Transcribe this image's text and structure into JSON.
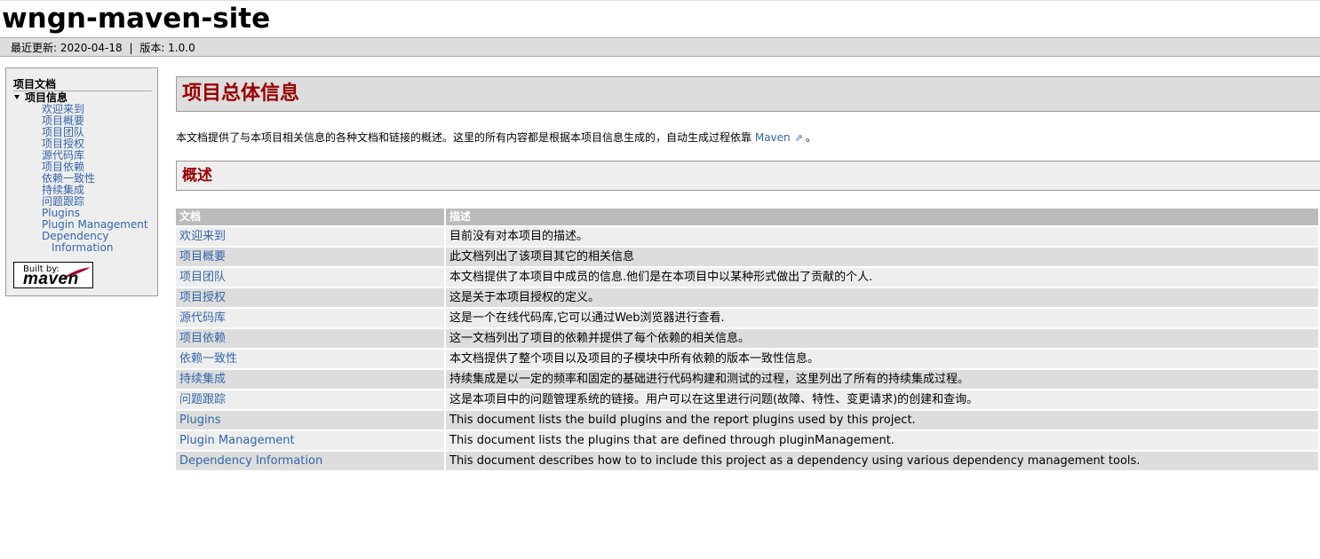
{
  "site": {
    "title": "wngn-maven-site"
  },
  "breadcrumbs": {
    "last_published": "最近更新: 2020-04-18",
    "separator": "|",
    "version": "版本: 1.0.0"
  },
  "nav": {
    "heading": "项目文档",
    "section": "项目信息",
    "items": [
      "欢迎来到",
      "项目概要",
      "项目团队",
      "项目授权",
      "源代码库",
      "项目依赖",
      "依赖一致性",
      "持续集成",
      "问题跟踪",
      "Plugins",
      "Plugin Management",
      "Dependency",
      "Information"
    ],
    "powered_by": {
      "built_by": "Built by:",
      "brand": "maven"
    }
  },
  "main": {
    "title": "项目总体信息",
    "intro_text": "本文档提供了与本项目相关信息的各种文档和链接的概述。这里的所有内容都是根据本项目信息生成的，自动生成过程依靠",
    "intro_link": "Maven",
    "intro_tail": "。",
    "section_title": "概述",
    "table": {
      "headers": [
        "文档",
        "描述"
      ],
      "rows": [
        [
          "欢迎来到",
          "目前没有对本项目的描述。"
        ],
        [
          "项目概要",
          "此文档列出了该项目其它的相关信息"
        ],
        [
          "项目团队",
          "本文档提供了本项目中成员的信息.他们是在本项目中以某种形式做出了贡献的个人."
        ],
        [
          "项目授权",
          "这是关于本项目授权的定义。"
        ],
        [
          "源代码库",
          "这是一个在线代码库,它可以通过Web浏览器进行查看."
        ],
        [
          "项目依赖",
          "这一文档列出了项目的依赖并提供了每个依赖的相关信息。"
        ],
        [
          "依赖一致性",
          "本文档提供了整个项目以及项目的子模块中所有依赖的版本一致性信息。"
        ],
        [
          "持续集成",
          "持续集成是以一定的频率和固定的基础进行代码构建和测试的过程，这里列出了所有的持续集成过程。"
        ],
        [
          "问题跟踪",
          "这是本项目中的问题管理系统的链接。用户可以在这里进行问题(故障、特性、变更请求)的创建和查询。"
        ],
        [
          "Plugins",
          "This document lists the build plugins and the report plugins used by this project."
        ],
        [
          "Plugin Management",
          "This document lists the plugins that are defined through pluginManagement."
        ],
        [
          "Dependency Information",
          "This document describes how to to include this project as a dependency using various dependency management tools."
        ]
      ]
    }
  },
  "colors": {
    "link": "#3366aa",
    "heading": "#990000",
    "header_bar": "#dddddd",
    "table_header": "#bbbbbb"
  }
}
